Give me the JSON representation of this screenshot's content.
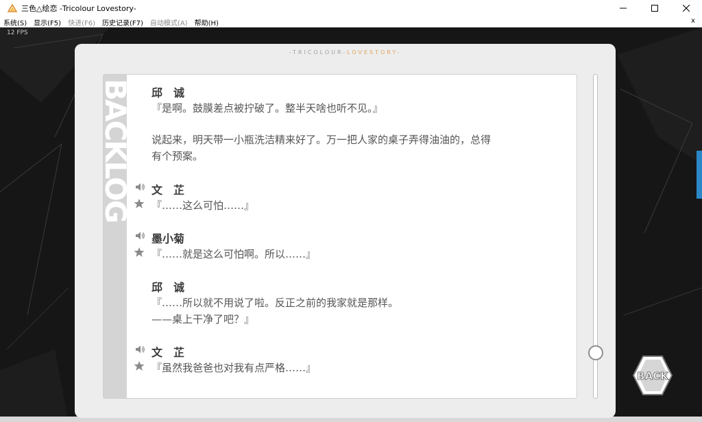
{
  "window": {
    "title": "三色△绘恋 -Tricolour Lovestory-",
    "minimize_icon": "minimize-icon",
    "maximize_icon": "maximize-icon",
    "close_icon": "close-icon"
  },
  "menu": {
    "items": [
      {
        "label": "系统(S)",
        "enabled": true
      },
      {
        "label": "显示(F5)",
        "enabled": true
      },
      {
        "label": "快进(F6)",
        "enabled": false
      },
      {
        "label": "历史记录(F7)",
        "enabled": true
      },
      {
        "label": "自动模式(A)",
        "enabled": false
      },
      {
        "label": "帮助(H)",
        "enabled": true
      }
    ],
    "close_label": "x"
  },
  "game": {
    "fps": "12 FPS",
    "header_left": "-TRICOLOUR-",
    "header_right": "LOVESTORY-",
    "backlog_label": "BACKLOG",
    "back_label": "BACK",
    "scroll_position": 0.88
  },
  "entries": [
    {
      "speaker": "邱　诚",
      "lines": [
        "『是啊。鼓膜差点被拧破了。整半天啥也听不见。』"
      ],
      "voice": false
    },
    {
      "speaker": "",
      "lines": [
        "说起来，明天带一小瓶洗洁精来好了。万一把人家的桌子弄得油油的，总得",
        "有个预案。"
      ],
      "voice": false
    },
    {
      "speaker": "文　芷",
      "lines": [
        "『……这么可怕……』"
      ],
      "voice": true
    },
    {
      "speaker": "墨小菊",
      "lines": [
        "『……就是这么可怕啊。所以……』"
      ],
      "voice": true
    },
    {
      "speaker": "邱　诚",
      "lines": [
        "『……所以就不用说了啦。反正之前的我家就是那样。",
        "——桌上干净了吧？』"
      ],
      "voice": false
    },
    {
      "speaker": "文　芷",
      "lines": [
        "『虽然我爸爸也对我有点严格……』"
      ],
      "voice": true
    }
  ],
  "colors": {
    "accent": "#e0a45a",
    "panel": "#ededed",
    "text": "#555555"
  }
}
